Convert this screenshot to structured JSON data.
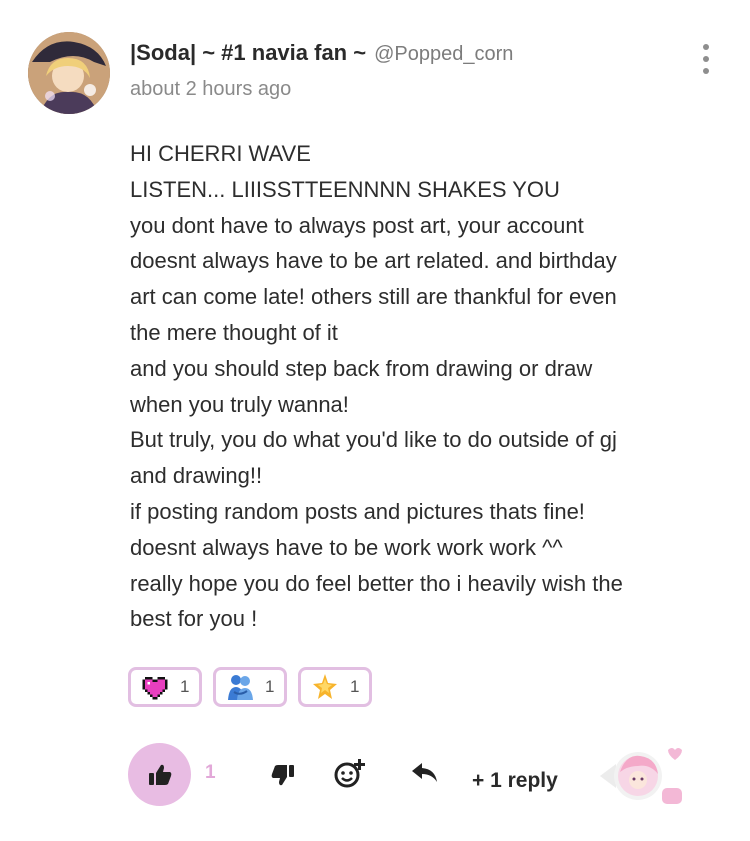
{
  "post": {
    "display_name": "|Soda| ~ #1 navia fan ~",
    "handle": "@Popped_corn",
    "timestamp": "about 2 hours ago",
    "lines": [
      "HI CHERRI WAVE",
      "LISTEN... LIIISSTTEENNNN SHAKES YOU",
      "you dont have to always post art, your account",
      "doesnt always have to be art related. and birthday",
      "art can come late! others still are thankful for even",
      "the mere thought of it",
      "and you should step back from drawing or draw",
      "when you truly wanna!",
      "But truly, you do what you'd like to do outside of gj",
      "and drawing!!",
      "if posting random posts and pictures thats fine!",
      "doesnt always have to be work work work ^^",
      "really hope you do feel better tho i heavily wish the",
      "best for you !"
    ]
  },
  "reactions": [
    {
      "icon": "pixel-heart-icon",
      "count": "1"
    },
    {
      "icon": "hugging-people-icon",
      "count": "1"
    },
    {
      "icon": "sparkle-star-icon",
      "count": "1"
    }
  ],
  "actions": {
    "like_count": "1",
    "reply_label": "+ 1 reply"
  },
  "colors": {
    "accent_pink": "#e8bce3",
    "reaction_border": "#e2bfe2",
    "like_count": "#e2a8d8"
  }
}
